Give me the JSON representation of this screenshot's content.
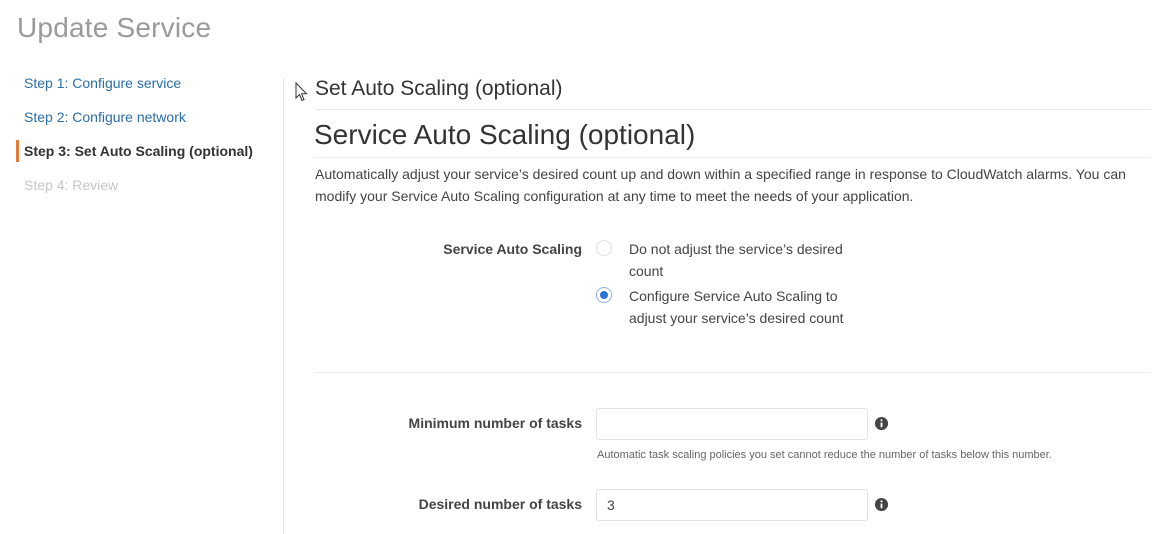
{
  "page": {
    "title": "Update Service"
  },
  "steps": [
    {
      "label": "Step 1: Configure service",
      "state": "link"
    },
    {
      "label": "Step 2: Configure network",
      "state": "link"
    },
    {
      "label": "Step 3: Set Auto Scaling (optional)",
      "state": "active"
    },
    {
      "label": "Step 4: Review",
      "state": "disabled"
    }
  ],
  "section": {
    "title": "Set Auto Scaling (optional)",
    "heading": "Service Auto Scaling (optional)",
    "description": "Automatically adjust your service’s desired count up and down within a specified range in response to CloudWatch alarms. You can modify your Service Auto Scaling configuration at any time to meet the needs of your application."
  },
  "auto_scaling": {
    "label": "Service Auto Scaling",
    "options": [
      {
        "label": "Do not adjust the service’s desired count",
        "selected": false
      },
      {
        "label": "Configure Service Auto Scaling to adjust your service’s desired count",
        "selected": true
      }
    ]
  },
  "min_tasks": {
    "label": "Minimum number of tasks",
    "value": "",
    "help": "Automatic task scaling policies you set cannot reduce the number of tasks below this number."
  },
  "desired_tasks": {
    "label": "Desired number of tasks",
    "value": "3"
  },
  "colors": {
    "accent": "#e07b39",
    "link": "#2b6ea8",
    "radio_selected": "#2a74d6"
  },
  "icons": {
    "cursor": "mouse-pointer-icon",
    "info": "info-circle-icon"
  }
}
